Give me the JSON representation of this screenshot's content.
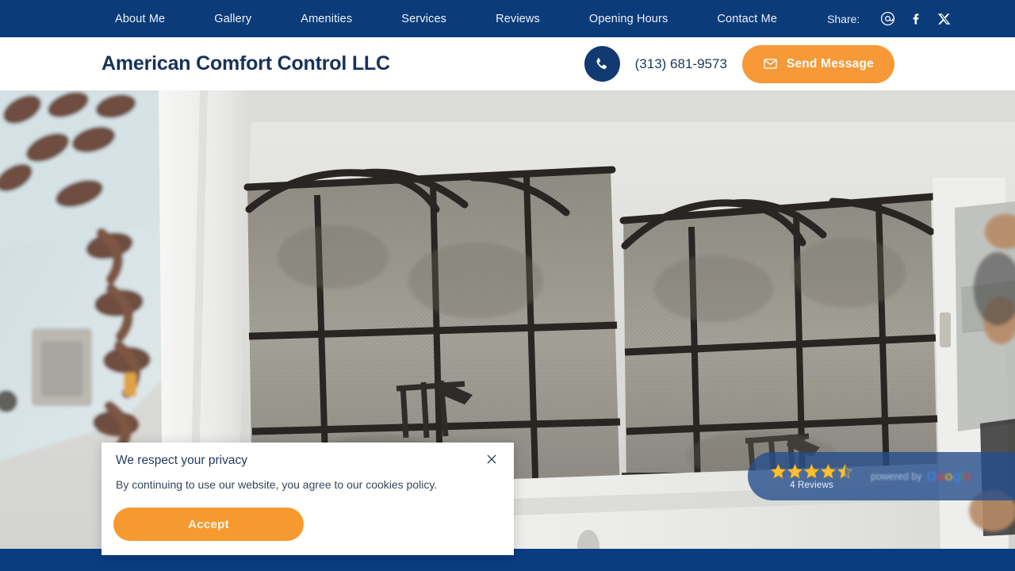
{
  "topnav": {
    "items": [
      {
        "label": "About Me",
        "name": "nav-about-me"
      },
      {
        "label": "Gallery",
        "name": "nav-gallery"
      },
      {
        "label": "Amenities",
        "name": "nav-amenities"
      },
      {
        "label": "Services",
        "name": "nav-services"
      },
      {
        "label": "Reviews",
        "name": "nav-reviews"
      },
      {
        "label": "Opening Hours",
        "name": "nav-opening-hours"
      },
      {
        "label": "Contact Me",
        "name": "nav-contact-me"
      }
    ],
    "share_label": "Share:",
    "share_icons": [
      "email-icon",
      "facebook-icon",
      "x-twitter-icon"
    ],
    "background_color": "#0c3b79",
    "text_color": "#eef3fa"
  },
  "header": {
    "brand": "American Comfort Control LLC",
    "brand_color": "#16325c",
    "phone": "(313) 681-9573",
    "phone_icon": "phone-icon",
    "phone_circle_color": "#123a72",
    "send_message_label": "Send Message",
    "send_message_icon": "envelope-icon",
    "accent_color": "#f79937"
  },
  "hero": {
    "alt": "Dirty air conditioner filter panels and copper coils of a disassembled HVAC unit"
  },
  "review_badge": {
    "rating": 4.5,
    "stars_total": 5,
    "reviews_label": "4 Reviews",
    "powered_by_label": "powered by",
    "provider": "Google",
    "background_color": "#244d8c"
  },
  "cookie_banner": {
    "title": "We respect your privacy",
    "message": "By continuing to use our website, you agree to our cookies policy.",
    "accept_label": "Accept",
    "close_icon": "close-icon",
    "accept_color": "#f6992e"
  },
  "footer": {
    "background_color": "#0a3c80"
  }
}
